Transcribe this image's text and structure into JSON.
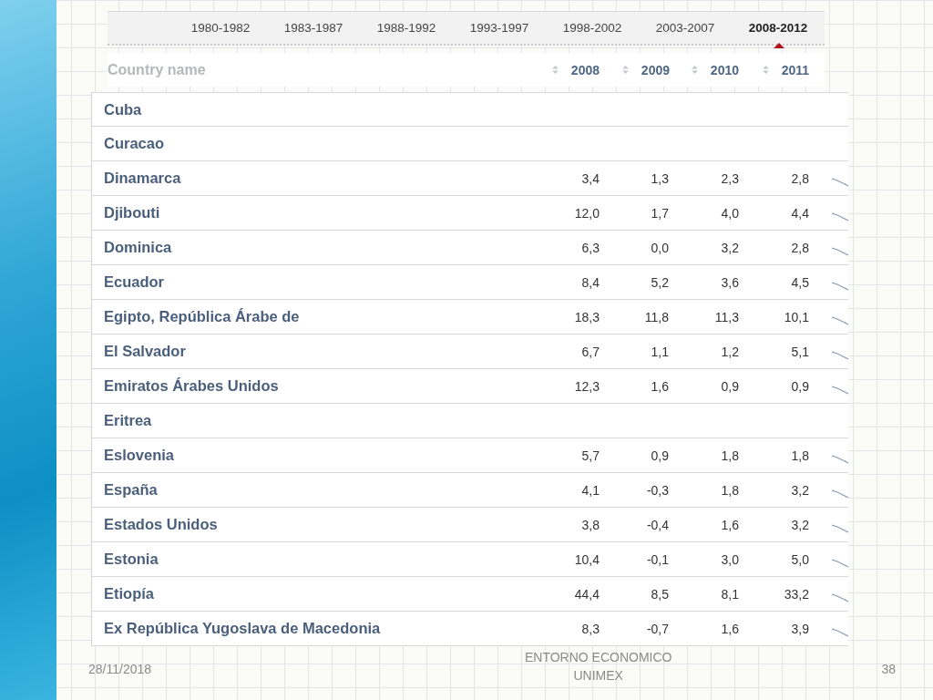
{
  "period_tabs": [
    {
      "label": "1980-1982",
      "selected": false
    },
    {
      "label": "1983-1987",
      "selected": false
    },
    {
      "label": "1988-1992",
      "selected": false
    },
    {
      "label": "1993-1997",
      "selected": false
    },
    {
      "label": "1998-2002",
      "selected": false
    },
    {
      "label": "2003-2007",
      "selected": false
    },
    {
      "label": "2008-2012",
      "selected": true
    }
  ],
  "table": {
    "name_column": "Country name",
    "columns": [
      "2008",
      "2009",
      "2010",
      "2011"
    ],
    "rows": [
      {
        "name": "Cuba"
      },
      {
        "name": "Curacao"
      },
      {
        "name": "Dinamarca",
        "values": [
          "3,4",
          "1,3",
          "2,3",
          "2,8"
        ]
      },
      {
        "name": "Djibouti",
        "values": [
          "12,0",
          "1,7",
          "4,0",
          "4,4"
        ]
      },
      {
        "name": "Dominica",
        "values": [
          "6,3",
          "0,0",
          "3,2",
          "2,8"
        ]
      },
      {
        "name": "Ecuador",
        "values": [
          "8,4",
          "5,2",
          "3,6",
          "4,5"
        ]
      },
      {
        "name": "Egipto, República Árabe de",
        "values": [
          "18,3",
          "11,8",
          "11,3",
          "10,1"
        ]
      },
      {
        "name": "El Salvador",
        "values": [
          "6,7",
          "1,1",
          "1,2",
          "5,1"
        ]
      },
      {
        "name": "Emiratos Árabes Unidos",
        "values": [
          "12,3",
          "1,6",
          "0,9",
          "0,9"
        ]
      },
      {
        "name": "Eritrea"
      },
      {
        "name": "Eslovenia",
        "values": [
          "5,7",
          "0,9",
          "1,8",
          "1,8"
        ]
      },
      {
        "name": "España",
        "values": [
          "4,1",
          "-0,3",
          "1,8",
          "3,2"
        ]
      },
      {
        "name": "Estados Unidos",
        "values": [
          "3,8",
          "-0,4",
          "1,6",
          "3,2"
        ]
      },
      {
        "name": "Estonia",
        "values": [
          "10,4",
          "-0,1",
          "3,0",
          "5,0"
        ]
      },
      {
        "name": "Etiopía",
        "values": [
          "44,4",
          "8,5",
          "8,1",
          "33,2"
        ]
      },
      {
        "name": "Ex República Yugoslava de Macedonia",
        "values": [
          "8,3",
          "-0,7",
          "1,6",
          "3,9"
        ]
      }
    ]
  },
  "footer": {
    "date": "28/11/2018",
    "title": "ENTORNO ECONOMICO",
    "subtitle": "UNIMEX",
    "page": "38"
  }
}
